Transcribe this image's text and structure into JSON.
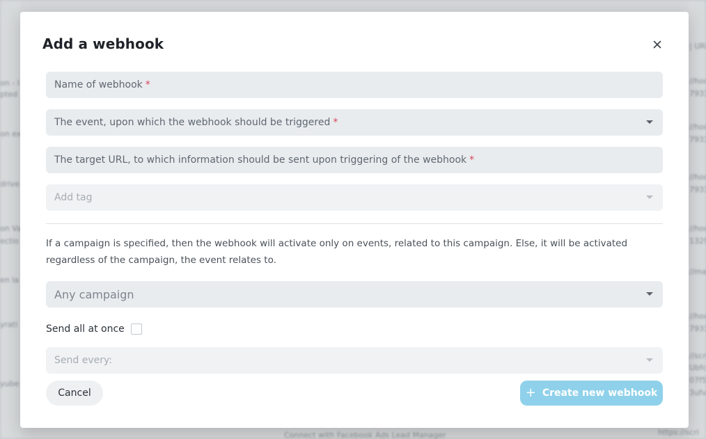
{
  "background": {
    "left_snippets": [
      "on - I",
      "pted",
      "on ex",
      "drive",
      "on Va",
      "ectio",
      "en la",
      "yrati",
      "yube"
    ],
    "right_snippets": [
      "| URL",
      "//hoo",
      "7933",
      "//hoo",
      "7933",
      "//hoo",
      "7933",
      "//hoo",
      "1329",
      "//ma",
      "//hoo",
      "7933",
      "//scri",
      "Ubfc",
      "07f5",
      "3ufvi",
      "https://scri"
    ],
    "bottom_snippet": "Connect with Facebook Ads Lead Manager"
  },
  "modal": {
    "title": "Add a webhook",
    "close_icon": "close-icon",
    "fields": {
      "name": {
        "label": "Name of webhook",
        "required_mark": "*"
      },
      "event": {
        "label": "The event, upon which the webhook should be triggered",
        "required_mark": "*"
      },
      "url": {
        "label": "The target URL, to which information should be sent upon triggering of the webhook",
        "required_mark": "*"
      },
      "tag": {
        "placeholder": "Add tag"
      },
      "campaign": {
        "value": "Any campaign"
      },
      "send_every": {
        "placeholder": "Send every:"
      }
    },
    "info_text": "If a campaign is specified, then the webhook will activate only on events, related to this campaign. Else, it will be activated regardless of the campaign, the event relates to.",
    "send_all": {
      "label": "Send all at once",
      "checked": false
    },
    "buttons": {
      "cancel": "Cancel",
      "create_icon": "+",
      "create": "Create new webhook"
    }
  },
  "colors": {
    "accent": "#8fd1ea",
    "required": "#d9465b",
    "field_bg": "#e9ecef"
  }
}
